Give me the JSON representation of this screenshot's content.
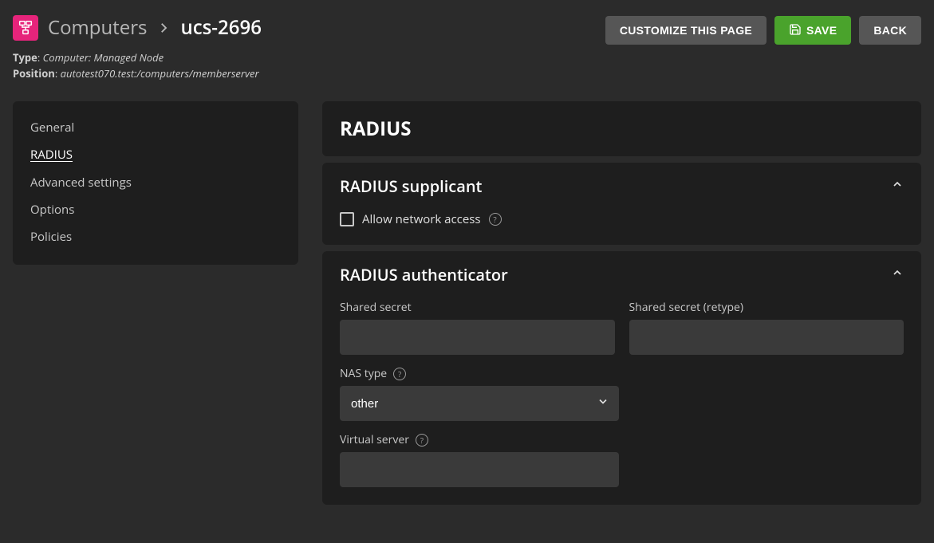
{
  "header": {
    "breadcrumb_root": "Computers",
    "breadcrumb_current": "ucs-2696",
    "type_label": "Type",
    "type_value": "Computer: Managed Node",
    "position_label": "Position",
    "position_value": "autotest070.test:/computers/memberserver",
    "customize_button": "CUSTOMIZE THIS PAGE",
    "save_button": "SAVE",
    "back_button": "BACK"
  },
  "sidebar": {
    "items": [
      {
        "label": "General",
        "active": false
      },
      {
        "label": "RADIUS",
        "active": true
      },
      {
        "label": "Advanced settings",
        "active": false
      },
      {
        "label": "Options",
        "active": false
      },
      {
        "label": "Policies",
        "active": false
      }
    ]
  },
  "main": {
    "title": "RADIUS",
    "supplicant": {
      "title": "RADIUS supplicant",
      "allow_network_label": "Allow network access",
      "allow_network_checked": false
    },
    "authenticator": {
      "title": "RADIUS authenticator",
      "shared_secret_label": "Shared secret",
      "shared_secret_value": "",
      "shared_secret_retype_label": "Shared secret (retype)",
      "shared_secret_retype_value": "",
      "nas_type_label": "NAS type",
      "nas_type_value": "other",
      "virtual_server_label": "Virtual server",
      "virtual_server_value": ""
    }
  }
}
